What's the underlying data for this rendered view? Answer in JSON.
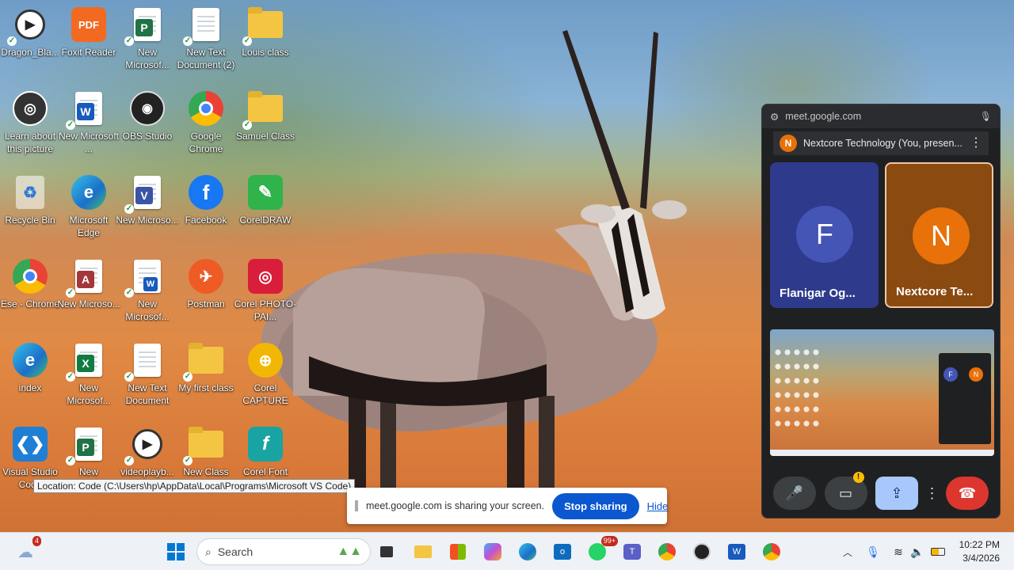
{
  "desktop_icons": [
    {
      "label": "Dragon_Bla..."
    },
    {
      "label": "Foxit Reader"
    },
    {
      "label": "New Microsof..."
    },
    {
      "label": "New Text Document (2)"
    },
    {
      "label": "Louis class"
    },
    {
      "label": "Learn about this picture"
    },
    {
      "label": "New Microsoft ..."
    },
    {
      "label": "OBS Studio"
    },
    {
      "label": "Google Chrome"
    },
    {
      "label": "Samuel Class"
    },
    {
      "label": "Recycle Bin"
    },
    {
      "label": "Microsoft Edge"
    },
    {
      "label": "New Microso..."
    },
    {
      "label": "Facebook"
    },
    {
      "label": "CorelDRAW"
    },
    {
      "label": "Ese - Chrome"
    },
    {
      "label": "New Microso..."
    },
    {
      "label": "New Microsof..."
    },
    {
      "label": "Postman"
    },
    {
      "label": "Corel PHOTO-PAI..."
    },
    {
      "label": "index"
    },
    {
      "label": "New Microsof..."
    },
    {
      "label": "New Text Document"
    },
    {
      "label": "My first class"
    },
    {
      "label": "Corel CAPTURE"
    },
    {
      "label": "Visual Studio Code"
    },
    {
      "label": "New"
    },
    {
      "label": "videoplayb..."
    },
    {
      "label": "New Class"
    },
    {
      "label": "Corel Font"
    }
  ],
  "tooltip": "Location: Code (C:\\Users\\hp\\AppData\\Local\\Programs\\Microsoft VS Code)",
  "share_bar": {
    "text": "meet.google.com is sharing your screen.",
    "stop_label": "Stop sharing",
    "hide_label": "Hide"
  },
  "meet": {
    "url": "meet.google.com",
    "header_initial": "N",
    "header_name": "Nextcore Technology (You, presen...",
    "participants": [
      {
        "initial": "F",
        "name": "Flanigar Og..."
      },
      {
        "initial": "N",
        "name": "Nextcore Te..."
      }
    ],
    "preview_initials": [
      "F",
      "N"
    ]
  },
  "taskbar": {
    "weather_badge": "4",
    "search_placeholder": "Search",
    "whatsapp_badge": "99+",
    "time": "10:22 PM",
    "date": "3/4/2026"
  }
}
